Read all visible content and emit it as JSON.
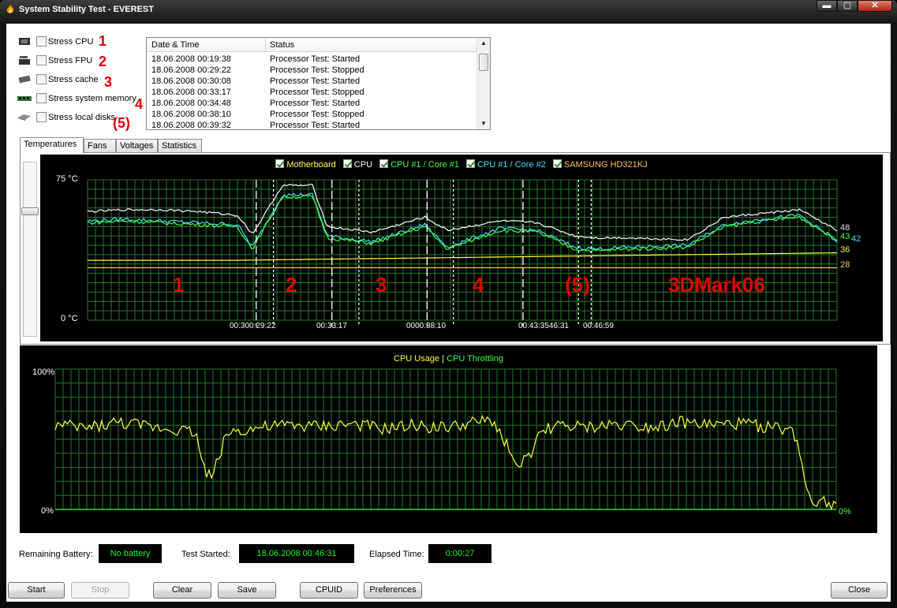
{
  "window": {
    "title": "System Stability Test - EVEREST",
    "min": "▬",
    "max": "▢",
    "close": "✕"
  },
  "stress": [
    {
      "label": "Stress CPU",
      "icon": "cpu-chip-icon",
      "annotation": "1"
    },
    {
      "label": "Stress FPU",
      "icon": "fpu-chip-icon",
      "annotation": "2"
    },
    {
      "label": "Stress cache",
      "icon": "cache-chip-icon",
      "annotation": "3"
    },
    {
      "label": "Stress system memory",
      "icon": "memory-module-icon",
      "annotation": "4"
    },
    {
      "label": "Stress local disks",
      "icon": "hard-disk-icon",
      "annotation": "(5)"
    }
  ],
  "log": {
    "col_datetime": "Date & Time",
    "col_status": "Status",
    "rows": [
      {
        "time": "18.06.2008 00:19:38",
        "status": "Processor Test: Started"
      },
      {
        "time": "18.06.2008 00:29:22",
        "status": "Processor Test: Stopped"
      },
      {
        "time": "18.06.2008 00:30:08",
        "status": "Processor Test: Started"
      },
      {
        "time": "18.06.2008 00:33:17",
        "status": "Processor Test: Stopped"
      },
      {
        "time": "18.06.2008 00:34:48",
        "status": "Processor Test: Started"
      },
      {
        "time": "18.06.2008 00:38:10",
        "status": "Processor Test: Stopped"
      },
      {
        "time": "18.06.2008 00:39:32",
        "status": "Processor Test: Started"
      }
    ]
  },
  "tabs": [
    "Temperatures",
    "Fans",
    "Voltages",
    "Statistics"
  ],
  "temp_graph": {
    "legend": [
      {
        "name": "Motherboard",
        "color": "#ffff40"
      },
      {
        "name": "CPU",
        "color": "#ffffff"
      },
      {
        "name": "CPU #1 / Core #1",
        "color": "#40ff40"
      },
      {
        "name": "CPU #1 / Core #2",
        "color": "#40e0ff"
      },
      {
        "name": "SAMSUNG HD321KJ",
        "color": "#ffc060"
      }
    ],
    "y_max": "75 °C",
    "y_min": "0 °C",
    "markers": [
      "00:30",
      "00:29:22",
      "00:33:17",
      "00:38:10",
      "00:43:35",
      "00:46:31",
      "00:46:59"
    ],
    "marker_texts": [
      "00:300:29:22",
      "00:33:17",
      "0000:38:10",
      "00:43:3546:31",
      "00:46:59"
    ],
    "segment_labels": [
      "1",
      "2",
      "3",
      "4",
      "(5)",
      "3DMark06"
    ],
    "end_values": [
      "48",
      "43",
      "42",
      "36",
      "28"
    ]
  },
  "cpu_graph": {
    "legend_usage": "CPU Usage",
    "legend_sep": "|",
    "legend_throttling": "CPU Throttling",
    "usage_color": "#ffff40",
    "throttle_color": "#40ff40",
    "y_max": "100%",
    "y_min": "0%",
    "end_value": "0%"
  },
  "chart_data": [
    {
      "type": "line",
      "title": "",
      "ylim": [
        0,
        75
      ],
      "ytick_labels": [
        "75 °C",
        "0 °C"
      ],
      "x_markers": [
        "00:30",
        "00:29:22",
        "00:33:17",
        "00:38:10",
        "00:43:35",
        "00:46:31",
        "00:46:59"
      ],
      "series": [
        {
          "name": "CPU",
          "x": [
            0,
            5,
            10,
            15,
            20,
            22,
            26,
            30,
            32,
            38,
            45,
            48,
            55,
            60,
            65,
            68,
            72,
            80,
            85,
            90,
            95,
            100
          ],
          "values": [
            58,
            59,
            59,
            58,
            56,
            46,
            72,
            72,
            50,
            47,
            55,
            48,
            53,
            52,
            45,
            44,
            44,
            43,
            55,
            57,
            59,
            48
          ]
        },
        {
          "name": "CPU #1 / Core #1",
          "x": [
            0,
            5,
            10,
            15,
            20,
            22,
            26,
            30,
            32,
            38,
            45,
            48,
            55,
            60,
            65,
            68,
            72,
            80,
            85,
            90,
            95,
            100
          ],
          "values": [
            52,
            53,
            52,
            51,
            50,
            38,
            66,
            66,
            44,
            41,
            50,
            38,
            48,
            47,
            38,
            37,
            38,
            39,
            50,
            53,
            55,
            43
          ]
        },
        {
          "name": "CPU #1 / Core #2",
          "x": [
            0,
            5,
            10,
            15,
            20,
            22,
            26,
            30,
            32,
            38,
            45,
            48,
            55,
            60,
            65,
            68,
            72,
            80,
            85,
            90,
            95,
            100
          ],
          "values": [
            53,
            54,
            53,
            52,
            51,
            39,
            67,
            67,
            45,
            42,
            51,
            39,
            49,
            48,
            39,
            38,
            39,
            40,
            51,
            54,
            56,
            42
          ]
        },
        {
          "name": "Motherboard",
          "x": [
            0,
            20,
            40,
            60,
            80,
            100
          ],
          "values": [
            32,
            32,
            33,
            34,
            35,
            36
          ]
        },
        {
          "name": "SAMSUNG HD321KJ",
          "x": [
            0,
            100
          ],
          "values": [
            28,
            28
          ]
        }
      ]
    },
    {
      "type": "line",
      "title": "",
      "ylim": [
        0,
        100
      ],
      "ytick_labels": [
        "100%",
        "0%"
      ],
      "series": [
        {
          "name": "CPU Usage",
          "x": [
            0,
            4,
            8,
            12,
            16,
            18,
            19,
            20,
            22,
            26,
            30,
            34,
            38,
            42,
            46,
            50,
            54,
            56,
            58,
            59,
            60,
            61,
            62,
            64,
            68,
            72,
            76,
            80,
            84,
            88,
            92,
            94,
            95,
            96,
            97,
            98,
            100
          ],
          "values": [
            60,
            58,
            62,
            59,
            57,
            55,
            30,
            22,
            55,
            58,
            60,
            59,
            61,
            57,
            60,
            58,
            62,
            63,
            45,
            28,
            38,
            35,
            55,
            60,
            58,
            61,
            59,
            62,
            60,
            61,
            58,
            57,
            50,
            20,
            5,
            8,
            2
          ]
        },
        {
          "name": "CPU Throttling",
          "x": [
            0,
            100
          ],
          "values": [
            0,
            0
          ]
        }
      ]
    }
  ],
  "status": {
    "battery_label": "Remaining Battery:",
    "battery_value": "No battery",
    "started_label": "Test Started:",
    "started_value": "18.06.2008 00:46:31",
    "elapsed_label": "Elapsed Time:",
    "elapsed_value": "0:00:27"
  },
  "buttons": {
    "start": "Start",
    "stop": "Stop",
    "clear": "Clear",
    "save": "Save",
    "cpuid": "CPUID",
    "preferences": "Preferences",
    "close": "Close"
  }
}
